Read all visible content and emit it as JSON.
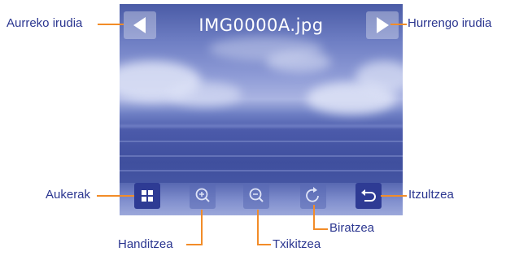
{
  "viewer": {
    "filename": "IMG0000A.jpg"
  },
  "icons": {
    "prev": "left-arrow-icon",
    "next": "right-arrow-icon",
    "options": "grid-icon",
    "zoom_in": "zoom-in-icon",
    "zoom_out": "zoom-out-icon",
    "rotate": "rotate-icon",
    "back": "return-arrow-icon"
  },
  "callouts": {
    "prev": "Aurreko irudia",
    "next": "Hurrengo irudia",
    "options": "Aukerak",
    "back": "Itzultzea",
    "rotate": "Biratzea",
    "zoom_in": "Handitzea",
    "zoom_out": "Txikitzea"
  },
  "colors": {
    "callout_line": "#f28c28",
    "callout_text": "#2b3690",
    "button_fill": "#2e3b94"
  }
}
